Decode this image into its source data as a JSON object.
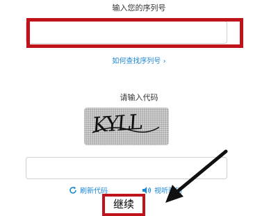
{
  "serial_section": {
    "label": "输入您的序列号",
    "input_value": "",
    "find_link": "如何查找序列号 ›"
  },
  "code_section": {
    "label": "请输入代码",
    "captcha_text": "KYLL",
    "input_value": ""
  },
  "actions": {
    "refresh_label": "刷新代码",
    "audio_label": "视听验码"
  },
  "continue_label": "继续",
  "colors": {
    "link": "#1a86d6",
    "highlight": "#c0121b"
  }
}
